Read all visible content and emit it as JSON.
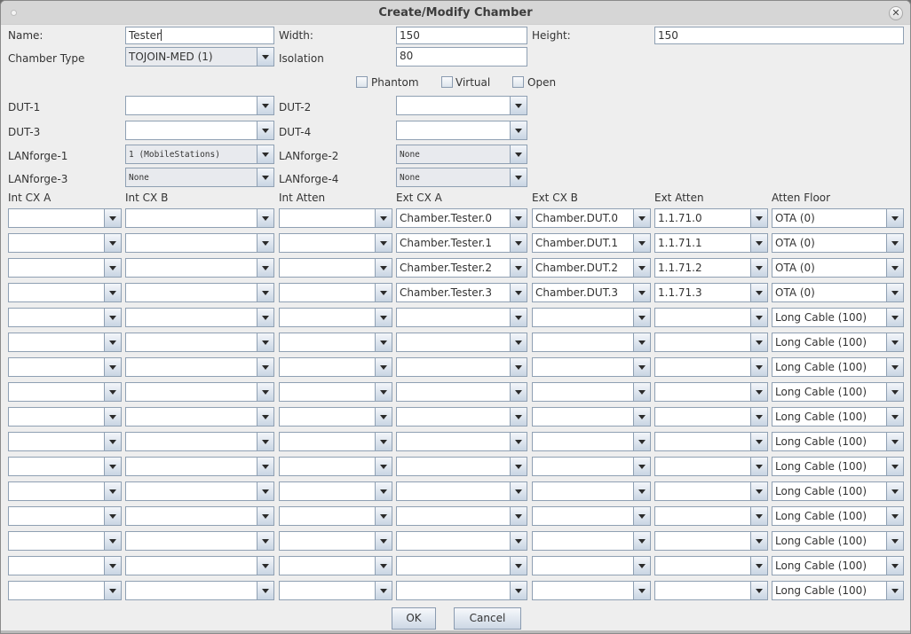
{
  "window": {
    "title": "Create/Modify Chamber"
  },
  "form": {
    "name_label": "Name:",
    "name_value": "Tester",
    "width_label": "Width:",
    "width_value": "150",
    "height_label": "Height:",
    "height_value": "150",
    "chamber_type_label": "Chamber Type",
    "chamber_type_value": "TOJOIN-MED (1)",
    "isolation_label": "Isolation",
    "isolation_value": "80",
    "checkboxes": [
      {
        "label": "Phantom",
        "checked": false
      },
      {
        "label": "Virtual",
        "checked": false
      },
      {
        "label": "Open",
        "checked": false
      }
    ],
    "dut1_label": "DUT-1",
    "dut1_value": "",
    "dut2_label": "DUT-2",
    "dut2_value": "",
    "dut3_label": "DUT-3",
    "dut3_value": "",
    "dut4_label": "DUT-4",
    "dut4_value": "",
    "lanforge1_label": "LANforge-1",
    "lanforge1_value": "1 (MobileStations)",
    "lanforge2_label": "LANforge-2",
    "lanforge2_value": "None",
    "lanforge3_label": "LANforge-3",
    "lanforge3_value": "None",
    "lanforge4_label": "LANforge-4",
    "lanforge4_value": "None"
  },
  "grid": {
    "headers": [
      "Int CX A",
      "Int CX B",
      "Int Atten",
      "Ext CX A",
      "Ext CX B",
      "Ext Atten",
      "Atten Floor"
    ],
    "rows": [
      [
        "",
        "",
        "",
        "Chamber.Tester.0",
        "Chamber.DUT.0",
        "1.1.71.0",
        "OTA (0)"
      ],
      [
        "",
        "",
        "",
        "Chamber.Tester.1",
        "Chamber.DUT.1",
        "1.1.71.1",
        "OTA (0)"
      ],
      [
        "",
        "",
        "",
        "Chamber.Tester.2",
        "Chamber.DUT.2",
        "1.1.71.2",
        "OTA (0)"
      ],
      [
        "",
        "",
        "",
        "Chamber.Tester.3",
        "Chamber.DUT.3",
        "1.1.71.3",
        "OTA (0)"
      ],
      [
        "",
        "",
        "",
        "",
        "",
        "",
        "Long Cable (100)"
      ],
      [
        "",
        "",
        "",
        "",
        "",
        "",
        "Long Cable (100)"
      ],
      [
        "",
        "",
        "",
        "",
        "",
        "",
        "Long Cable (100)"
      ],
      [
        "",
        "",
        "",
        "",
        "",
        "",
        "Long Cable (100)"
      ],
      [
        "",
        "",
        "",
        "",
        "",
        "",
        "Long Cable (100)"
      ],
      [
        "",
        "",
        "",
        "",
        "",
        "",
        "Long Cable (100)"
      ],
      [
        "",
        "",
        "",
        "",
        "",
        "",
        "Long Cable (100)"
      ],
      [
        "",
        "",
        "",
        "",
        "",
        "",
        "Long Cable (100)"
      ],
      [
        "",
        "",
        "",
        "",
        "",
        "",
        "Long Cable (100)"
      ],
      [
        "",
        "",
        "",
        "",
        "",
        "",
        "Long Cable (100)"
      ],
      [
        "",
        "",
        "",
        "",
        "",
        "",
        "Long Cable (100)"
      ],
      [
        "",
        "",
        "",
        "",
        "",
        "",
        "Long Cable (100)"
      ]
    ]
  },
  "buttons": {
    "ok": "OK",
    "cancel": "Cancel"
  }
}
